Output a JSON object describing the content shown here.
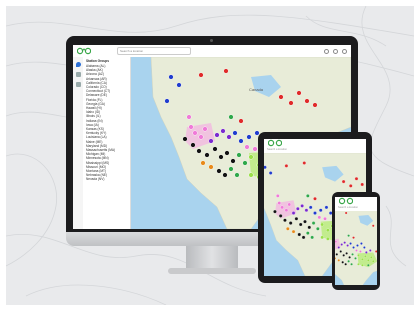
{
  "app": {
    "search_placeholder": "Search a location",
    "mobile_search_placeholder": "Search a location"
  },
  "sidebar": {
    "header": "Station Groups",
    "states": [
      "Alabama (AL)",
      "Alaska (AK)",
      "Arizona (AZ)",
      "Arkansas (AR)",
      "California (CA)",
      "Colorado (CO)",
      "Connecticut (CT)",
      "Delaware (DE)",
      "Florida (FL)",
      "Georgia (GA)",
      "Hawaii (HI)",
      "Idaho (ID)",
      "Illinois (IL)",
      "Indiana (IN)",
      "Iowa (IA)",
      "Kansas (KS)",
      "Kentucky (KY)",
      "Louisiana (LA)",
      "Maine (ME)",
      "Maryland (MD)",
      "Massachusetts (MA)",
      "Michigan (MI)",
      "Minnesota (MN)",
      "Mississippi (MS)",
      "Missouri (MO)",
      "Montana (MT)",
      "Nebraska (NE)",
      "Nevada (NV)"
    ]
  },
  "map": {
    "country_label": "Canada"
  },
  "colors": {
    "land": "#e8ecd8",
    "water": "#a9d3ee",
    "markers": [
      "#e02a2a",
      "#1f3bcf",
      "#7a2ad0",
      "#f07ad8",
      "#2ea84a",
      "#9be04a",
      "#111111",
      "#e88a1a"
    ]
  },
  "icons": [
    "layers-icon",
    "location-pin-icon",
    "settings-icon",
    "user-icon",
    "menu-icon"
  ]
}
